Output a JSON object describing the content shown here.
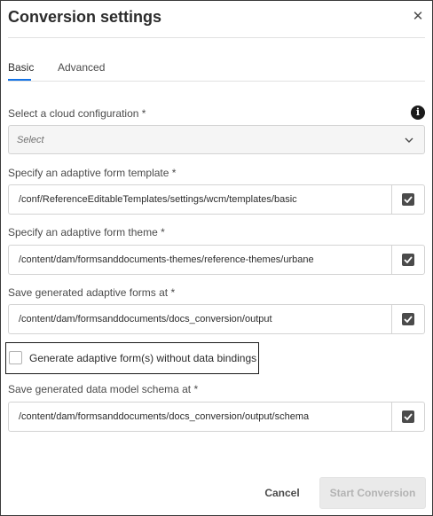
{
  "dialog": {
    "title": "Conversion settings",
    "close_icon": "close-icon"
  },
  "tabs": [
    {
      "label": "Basic",
      "active": true
    },
    {
      "label": "Advanced",
      "active": false
    }
  ],
  "cloud_config": {
    "label": "Select a cloud configuration *",
    "info_icon": "info-icon",
    "placeholder": "Select",
    "dropdown_icon": "chevron-down-icon"
  },
  "template": {
    "label": "Specify an adaptive form template *",
    "value": "/conf/ReferenceEditableTemplates/settings/wcm/templates/basic",
    "checked": true
  },
  "theme": {
    "label": "Specify an adaptive form theme *",
    "value": "/content/dam/formsanddocuments-themes/reference-themes/urbane",
    "checked": true
  },
  "save_forms": {
    "label": "Save generated adaptive forms at *",
    "value": "/content/dam/formsanddocuments/docs_conversion/output",
    "checked": true
  },
  "generate_without_bindings": {
    "label": "Generate adaptive form(s) without data bindings",
    "checked": false
  },
  "save_schema": {
    "label": "Save generated data model schema at *",
    "value": "/content/dam/formsanddocuments/docs_conversion/output/schema",
    "checked": true
  },
  "footer": {
    "cancel_label": "Cancel",
    "start_label": "Start Conversion"
  },
  "colors": {
    "accent": "#1473e6",
    "checkbox_fill": "#4b4b4b",
    "disabled_button": "#eaeaea"
  }
}
